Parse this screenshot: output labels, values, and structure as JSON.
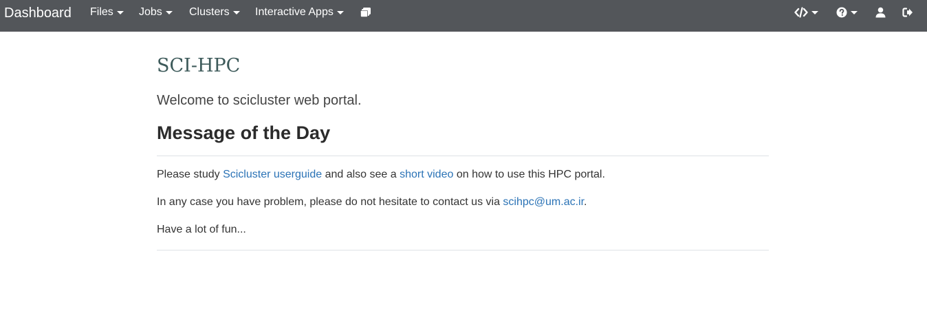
{
  "navbar": {
    "brand": "Dashboard",
    "menus": [
      {
        "label": "Files"
      },
      {
        "label": "Jobs"
      },
      {
        "label": "Clusters"
      },
      {
        "label": "Interactive Apps"
      }
    ],
    "icons": [
      "sessions-icon",
      "code-icon",
      "help-icon",
      "user-icon",
      "logout-icon"
    ],
    "background": "#53565a"
  },
  "main": {
    "site_title": "SCI-HPC",
    "welcome": "Welcome to scicluster web portal.",
    "motd_heading": "Message of the Day",
    "line1": {
      "t1": "Please study ",
      "link1": "Scicluster userguide",
      "t2": " and also see a ",
      "link2": "short video",
      "t3": " on how to use this HPC portal."
    },
    "line2": {
      "t1": "In any case you have problem, please do not hesitate to contact us via ",
      "link": "scihpc@um.ac.ir",
      "t2": "."
    },
    "line3": "Have a lot of fun...",
    "link_color": "#2b73b6"
  }
}
